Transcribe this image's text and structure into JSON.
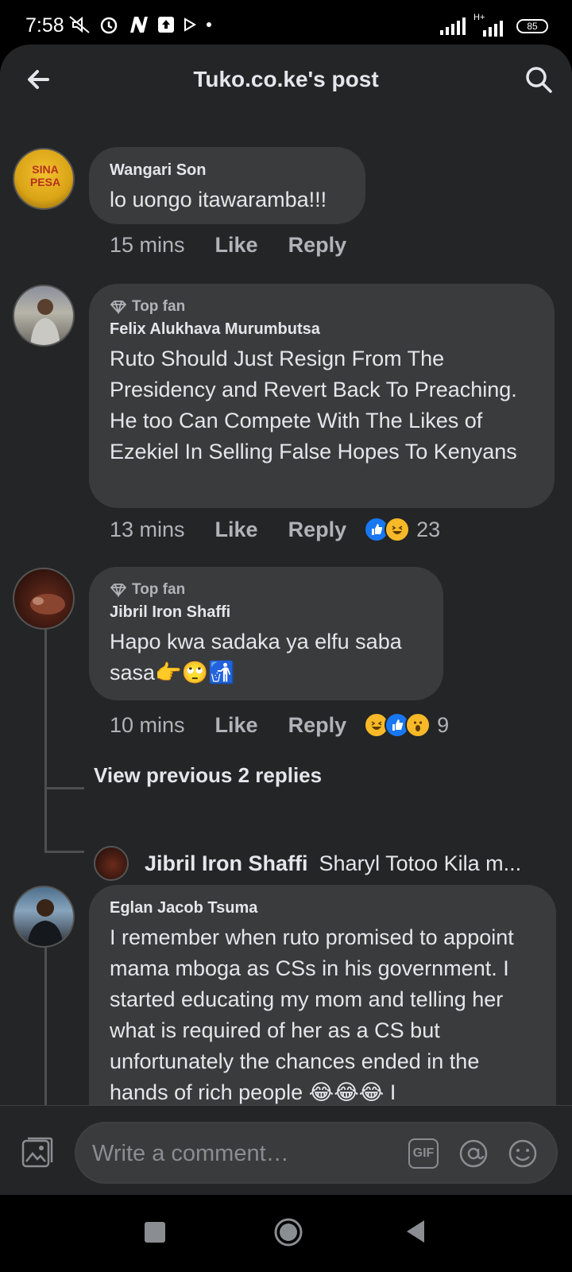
{
  "status_bar": {
    "time": "7:58",
    "left_icons": [
      "mute-icon",
      "alarm-icon",
      "n-app-icon",
      "upload-icon",
      "play-icon",
      "dot-icon"
    ],
    "network": "H+",
    "battery": "85"
  },
  "header": {
    "title": "Tuko.co.ke's post"
  },
  "comments": [
    {
      "author": "Wangari Son",
      "badge": "",
      "text": "lo uongo itawaramba!!!",
      "time": "15 mins",
      "like": "Like",
      "reply": "Reply",
      "reaction_count": ""
    },
    {
      "author": "Felix Alukhava Murumbutsa",
      "badge": "Top fan",
      "text": "Ruto Should Just Resign From The Presidency and Revert Back To Preaching. He too Can Compete With The Likes of Ezekiel In Selling False Hopes To Kenyans",
      "time": "13 mins",
      "like": "Like",
      "reply": "Reply",
      "reaction_count": "23"
    },
    {
      "author": "Jibril Iron Shaffi",
      "badge": "Top fan",
      "text": "Hapo kwa sadaka ya elfu saba sasa👉🙄🚮",
      "time": "10 mins",
      "like": "Like",
      "reply": "Reply",
      "reaction_count": "9"
    },
    {
      "author": "Eglan Jacob Tsuma",
      "badge": "",
      "text": "I remember when ruto promised to appoint mama mboga as CSs in his government. I started educating my mom and telling her what is required of her as a CS but unfortunately the chances ended in the hands of rich people 😂😂😂 I",
      "time": "",
      "like": "",
      "reply": "",
      "reaction_count": ""
    }
  ],
  "thread": {
    "view_previous": "View previous 2 replies",
    "reply_author": "Jibril Iron Shaffi",
    "reply_preview": "Sharyl Totoo Kila m..."
  },
  "composer": {
    "placeholder": "Write a comment…",
    "gif_label": "GIF"
  },
  "colors": {
    "background": "#242526",
    "bubble": "#3a3b3c",
    "text": "#e4e6eb",
    "secondary_text": "#b0b3b8",
    "like_blue": "#1877f2",
    "haha_yellow": "#f7b928"
  }
}
